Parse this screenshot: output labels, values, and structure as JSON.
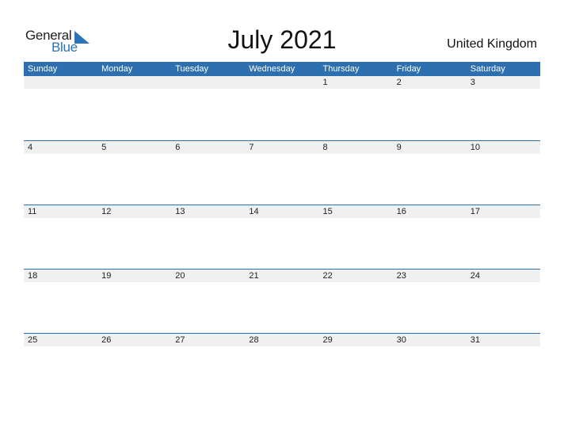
{
  "logo": {
    "word1": "General",
    "word2": "Blue",
    "accent": "#2a73b8"
  },
  "title": "July 2021",
  "country": "United Kingdom",
  "colors": {
    "header": "#2e6fb0",
    "strip": "#f0f0f0"
  },
  "weekdays": [
    "Sunday",
    "Monday",
    "Tuesday",
    "Wednesday",
    "Thursday",
    "Friday",
    "Saturday"
  ],
  "weeks": [
    [
      "",
      "",
      "",
      "",
      "1",
      "2",
      "3"
    ],
    [
      "4",
      "5",
      "6",
      "7",
      "8",
      "9",
      "10"
    ],
    [
      "11",
      "12",
      "13",
      "14",
      "15",
      "16",
      "17"
    ],
    [
      "18",
      "19",
      "20",
      "21",
      "22",
      "23",
      "24"
    ],
    [
      "25",
      "26",
      "27",
      "28",
      "29",
      "30",
      "31"
    ]
  ]
}
